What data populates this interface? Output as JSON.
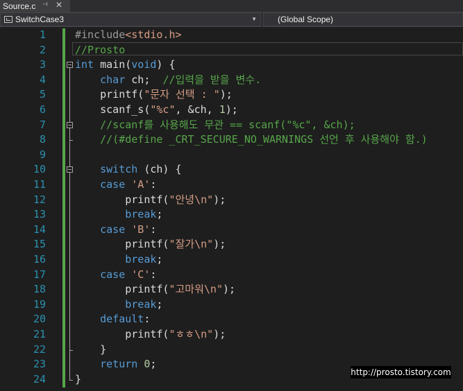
{
  "tab": {
    "title": "Source.c",
    "pin_glyph": "⊣",
    "close_glyph": "✕"
  },
  "nav": {
    "project": "SwitchCase3",
    "scope": "(Global Scope)"
  },
  "colors": {
    "keyword": "#569cd6",
    "string": "#d69d85",
    "comment": "#57a64a",
    "line_number": "#2b91af",
    "text": "#dcdcdc"
  },
  "lines": [
    {
      "n": "1",
      "segs": [
        [
          "pp",
          "#include"
        ],
        [
          "str",
          "<stdio.h>"
        ]
      ]
    },
    {
      "n": "2",
      "segs": [
        [
          "cm",
          "//Prosto"
        ]
      ]
    },
    {
      "n": "3",
      "segs": [
        [
          "kw",
          "int"
        ],
        [
          "t",
          " main("
        ],
        [
          "kw",
          "void"
        ],
        [
          "t",
          ") {"
        ]
      ]
    },
    {
      "n": "4",
      "segs": [
        [
          "t",
          "    "
        ],
        [
          "kw",
          "char"
        ],
        [
          "t",
          " ch;  "
        ],
        [
          "cm",
          "//입력을 받을 변수."
        ]
      ]
    },
    {
      "n": "5",
      "segs": [
        [
          "t",
          "    printf("
        ],
        [
          "str",
          "\"문자 선택 : \""
        ],
        [
          "t",
          ");"
        ]
      ]
    },
    {
      "n": "6",
      "segs": [
        [
          "t",
          "    scanf_s("
        ],
        [
          "str",
          "\"%c\""
        ],
        [
          "t",
          ", &ch, "
        ],
        [
          "num",
          "1"
        ],
        [
          "t",
          ");"
        ]
      ]
    },
    {
      "n": "7",
      "segs": [
        [
          "t",
          "    "
        ],
        [
          "cm",
          "//scanf를 사용해도 무관 == scanf(\"%c\", &ch);"
        ]
      ]
    },
    {
      "n": "8",
      "segs": [
        [
          "t",
          "    "
        ],
        [
          "cm",
          "//(#define _CRT_SECURE_NO_WARNINGS 선언 후 사용해야 함.)"
        ]
      ]
    },
    {
      "n": "9",
      "segs": []
    },
    {
      "n": "10",
      "segs": [
        [
          "t",
          "    "
        ],
        [
          "kw",
          "switch"
        ],
        [
          "t",
          " (ch) {"
        ]
      ]
    },
    {
      "n": "11",
      "segs": [
        [
          "t",
          "    "
        ],
        [
          "kw",
          "case"
        ],
        [
          "t",
          " "
        ],
        [
          "str",
          "'A'"
        ],
        [
          "t",
          ":"
        ]
      ]
    },
    {
      "n": "12",
      "segs": [
        [
          "t",
          "        printf("
        ],
        [
          "str",
          "\"안녕\\n\""
        ],
        [
          "t",
          ");"
        ]
      ]
    },
    {
      "n": "13",
      "segs": [
        [
          "t",
          "        "
        ],
        [
          "kw",
          "break"
        ],
        [
          "t",
          ";"
        ]
      ]
    },
    {
      "n": "14",
      "segs": [
        [
          "t",
          "    "
        ],
        [
          "kw",
          "case"
        ],
        [
          "t",
          " "
        ],
        [
          "str",
          "'B'"
        ],
        [
          "t",
          ":"
        ]
      ]
    },
    {
      "n": "15",
      "segs": [
        [
          "t",
          "        printf("
        ],
        [
          "str",
          "\"잘가\\n\""
        ],
        [
          "t",
          ");"
        ]
      ]
    },
    {
      "n": "16",
      "segs": [
        [
          "t",
          "        "
        ],
        [
          "kw",
          "break"
        ],
        [
          "t",
          ";"
        ]
      ]
    },
    {
      "n": "17",
      "segs": [
        [
          "t",
          "    "
        ],
        [
          "kw",
          "case"
        ],
        [
          "t",
          " "
        ],
        [
          "str",
          "'C'"
        ],
        [
          "t",
          ":"
        ]
      ]
    },
    {
      "n": "18",
      "segs": [
        [
          "t",
          "        printf("
        ],
        [
          "str",
          "\"고마워\\n\""
        ],
        [
          "t",
          ");"
        ]
      ]
    },
    {
      "n": "19",
      "segs": [
        [
          "t",
          "        "
        ],
        [
          "kw",
          "break"
        ],
        [
          "t",
          ";"
        ]
      ]
    },
    {
      "n": "20",
      "segs": [
        [
          "t",
          "    "
        ],
        [
          "kw",
          "default"
        ],
        [
          "t",
          ":"
        ]
      ]
    },
    {
      "n": "21",
      "segs": [
        [
          "t",
          "        printf("
        ],
        [
          "str",
          "\"ㅎㅎ\\n\""
        ],
        [
          "t",
          ");"
        ]
      ]
    },
    {
      "n": "22",
      "segs": [
        [
          "t",
          "    }"
        ]
      ]
    },
    {
      "n": "23",
      "segs": [
        [
          "t",
          "    "
        ],
        [
          "kw",
          "return"
        ],
        [
          "t",
          " "
        ],
        [
          "num",
          "0"
        ],
        [
          "t",
          ";"
        ]
      ]
    },
    {
      "n": "24",
      "segs": [
        [
          "t",
          "}"
        ]
      ]
    }
  ],
  "watermark": "http://prosto.tistory.com"
}
